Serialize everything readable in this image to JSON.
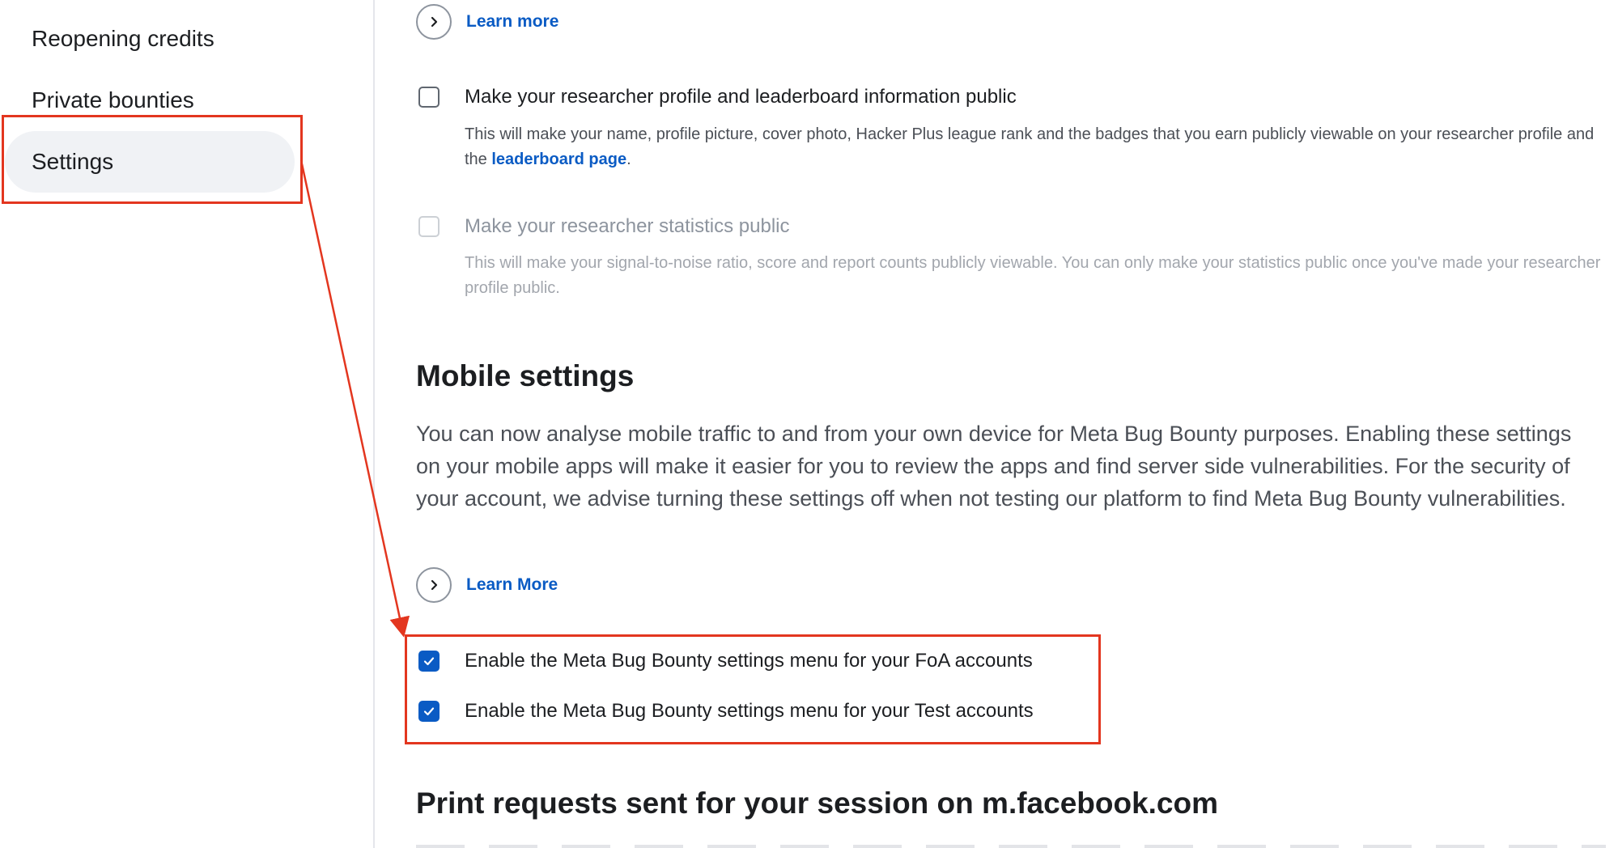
{
  "sidebar": {
    "items": [
      {
        "label": "Reopening credits"
      },
      {
        "label": "Private bounties"
      },
      {
        "label": "Settings"
      }
    ]
  },
  "privacy": {
    "learn_more_label": "Learn more",
    "profile_public": {
      "label": "Make your researcher profile and leaderboard information public",
      "desc_before": "This will make your name, profile picture, cover photo, Hacker Plus league rank and the badges that you earn publicly viewable on your researcher profile and the ",
      "desc_link": "leaderboard page",
      "desc_after": "."
    },
    "stats_public": {
      "label": "Make your researcher statistics public",
      "desc": "This will make your signal-to-noise ratio, score and report counts publicly viewable. You can only make your statistics public once you've made your researcher profile public."
    }
  },
  "mobile": {
    "title": "Mobile settings",
    "body": "You can now analyse mobile traffic to and from your own device for Meta Bug Bounty purposes. Enabling these settings on your mobile apps will make it easier for you to review the apps and find server side vulnerabilities. For the security of your account, we advise turning these settings off when not testing our platform to find Meta Bug Bounty vulnerabilities.",
    "learn_more_label": "Learn More",
    "foa_label": "Enable the Meta Bug Bounty settings menu for your FoA accounts",
    "test_label": "Enable the Meta Bug Bounty settings menu for your Test accounts"
  },
  "print_requests": {
    "title": "Print requests sent for your session on m.facebook.com"
  },
  "colors": {
    "accent": "#0a5bc4",
    "annotation": "#e3361f"
  },
  "icons": {
    "chevron": "chevron-right-icon",
    "check": "checkmark-icon"
  }
}
